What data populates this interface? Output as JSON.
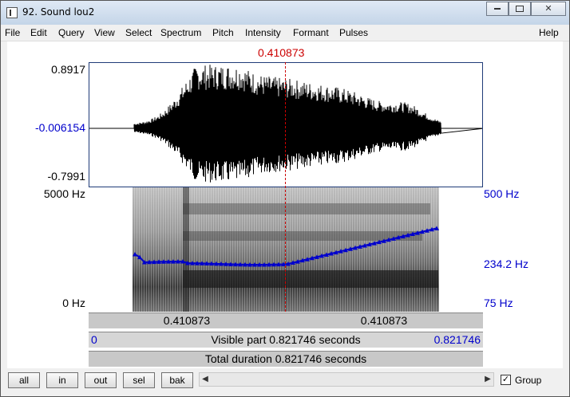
{
  "window": {
    "title": "92. Sound lou2",
    "buttons": [
      "minimize",
      "maximize",
      "close"
    ]
  },
  "menu": {
    "items": [
      "File",
      "Edit",
      "Query",
      "View",
      "Select",
      "Spectrum",
      "Pitch",
      "Intensity",
      "Formant",
      "Pulses"
    ],
    "help": "Help"
  },
  "cursor": {
    "time": "0.410873",
    "color": "#cc0000"
  },
  "waveform": {
    "max": "0.8917",
    "zero": "-0.006154",
    "min": "-0.7991"
  },
  "spectrogram": {
    "top": "5000 Hz",
    "bottom": "0 Hz"
  },
  "pitch": {
    "top": "500 Hz",
    "current": "234.2 Hz",
    "bottom": "75 Hz",
    "color": "#0000cc"
  },
  "timebars": {
    "left_segment": "0.410873",
    "right_segment": "0.410873",
    "visible_start": "0",
    "visible_text": "Visible part 0.821746 seconds",
    "visible_end": "0.821746",
    "total_text": "Total duration 0.821746 seconds"
  },
  "bottom": {
    "buttons": [
      "all",
      "in",
      "out",
      "sel",
      "bak"
    ],
    "group_label": "Group",
    "group_checked": true
  }
}
